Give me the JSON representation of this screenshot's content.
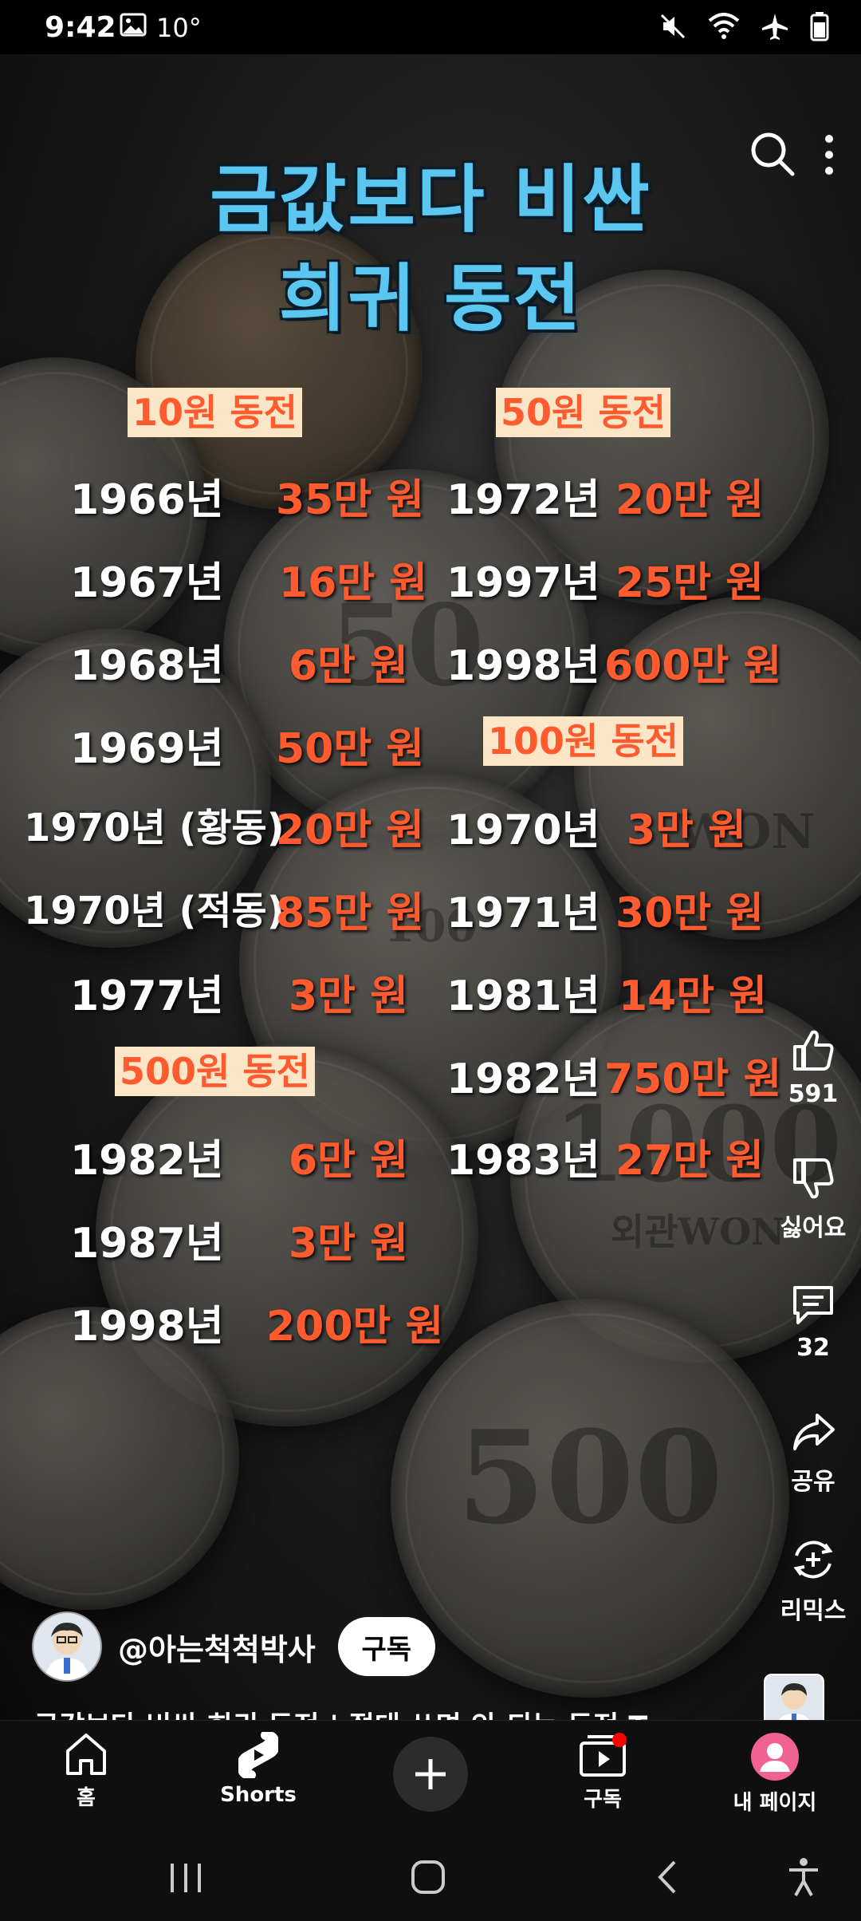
{
  "status_bar": {
    "time": "9:42",
    "temp": "10°"
  },
  "video": {
    "title_line1": "금값보다 비싼",
    "title_line2": "희귀 동전",
    "coin_engravings": [
      "WON",
      "100",
      "500",
      "50",
      "WON",
      "1000",
      "외관WON"
    ],
    "sections": {
      "s10": {
        "label": "10원 동전"
      },
      "s50": {
        "label": "50원 동전"
      },
      "s100": {
        "label": "100원 동전"
      },
      "s500": {
        "label": "500원 동전"
      }
    },
    "rows": [
      {
        "year": "1966년",
        "price": "35만 원"
      },
      {
        "year": "1967년",
        "price": "16만 원"
      },
      {
        "year": "1968년",
        "price": "6만 원"
      },
      {
        "year": "1969년",
        "price": "50만 원"
      },
      {
        "year": "1970년 (황동)",
        "price": "20만 원"
      },
      {
        "year": "1970년 (적동)",
        "price": "85만 원"
      },
      {
        "year": "1977년",
        "price": "3만 원"
      },
      {
        "year": "1982년",
        "price": "6만 원"
      },
      {
        "year": "1987년",
        "price": "3만 원"
      },
      {
        "year": "1998년",
        "price": "200만 원"
      },
      {
        "year": "1972년",
        "price": "20만 원"
      },
      {
        "year": "1997년",
        "price": "25만 원"
      },
      {
        "year": "1998년",
        "price": "600만 원"
      },
      {
        "year": "1970년",
        "price": "3만 원"
      },
      {
        "year": "1971년",
        "price": "30만 원"
      },
      {
        "year": "1981년",
        "price": "14만 원"
      },
      {
        "year": "1982년",
        "price": "750만 원"
      },
      {
        "year": "1983년",
        "price": "27만 원"
      }
    ]
  },
  "actions": {
    "like_count": "591",
    "dislike_label": "싫어요",
    "comment_count": "32",
    "share_label": "공유",
    "remix_label": "리믹스"
  },
  "channel": {
    "handle": "@아는척척박사",
    "subscribe_label": "구독",
    "description": "금값보다 비싼 희귀 동전 | 절대 쓰면 안 되는 동전 T ..."
  },
  "bottom_nav": {
    "home": "홈",
    "shorts": "Shorts",
    "subscriptions": "구독",
    "my_page": "내 페이지"
  },
  "colors": {
    "title": "#5bc6f0",
    "price": "#ff5b2e",
    "label_bg": "#fbe7c8",
    "notification": "#ff0000",
    "profile": "#f06292"
  }
}
